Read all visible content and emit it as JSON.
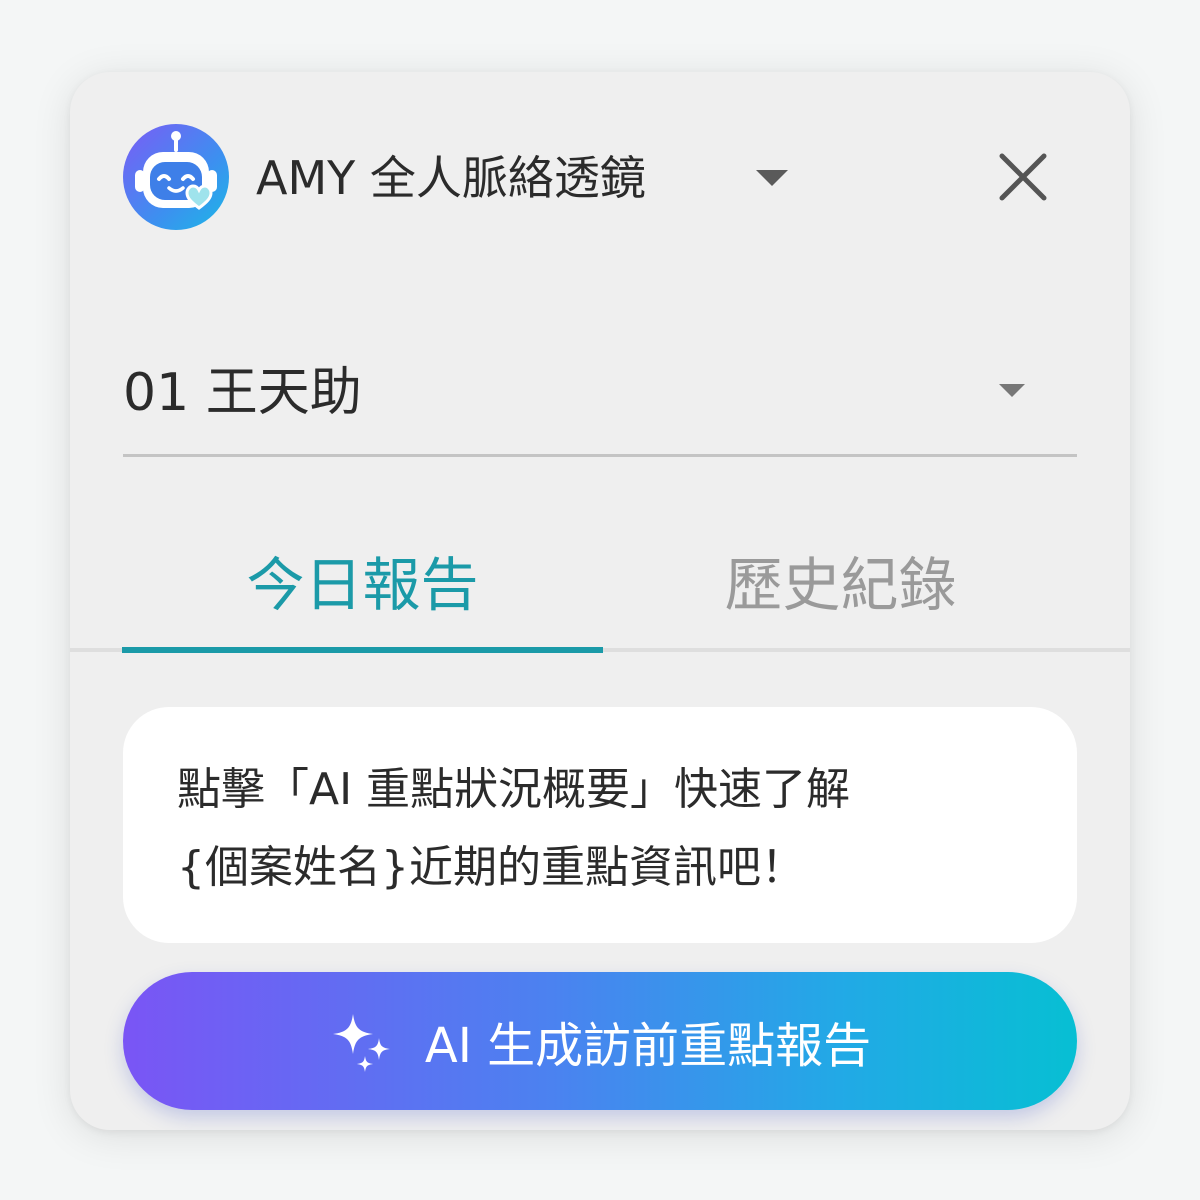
{
  "header": {
    "title": "AMY 全人脈絡透鏡",
    "avatar_icon": "robot-avatar-icon",
    "menu_icon": "caret-down-icon",
    "close_icon": "close-icon"
  },
  "client_select": {
    "value": "01 王天助",
    "icon": "caret-down-icon"
  },
  "tabs": [
    {
      "label": "今日報告",
      "active": true
    },
    {
      "label": "歷史紀錄",
      "active": false
    }
  ],
  "message": {
    "lines": [
      "點擊「AI 重點狀況概要」快速了解",
      "{個案姓名}近期的重點資訊吧！"
    ]
  },
  "cta": {
    "label": "AI 生成訪前重點報告",
    "icon": "sparkle-icon"
  },
  "colors": {
    "accent": "#1b9aa8",
    "tab_inactive": "#9a9a9a",
    "gradient_start": "#7a55f5",
    "gradient_end": "#07bfd3",
    "panel_bg": "#efefef"
  }
}
